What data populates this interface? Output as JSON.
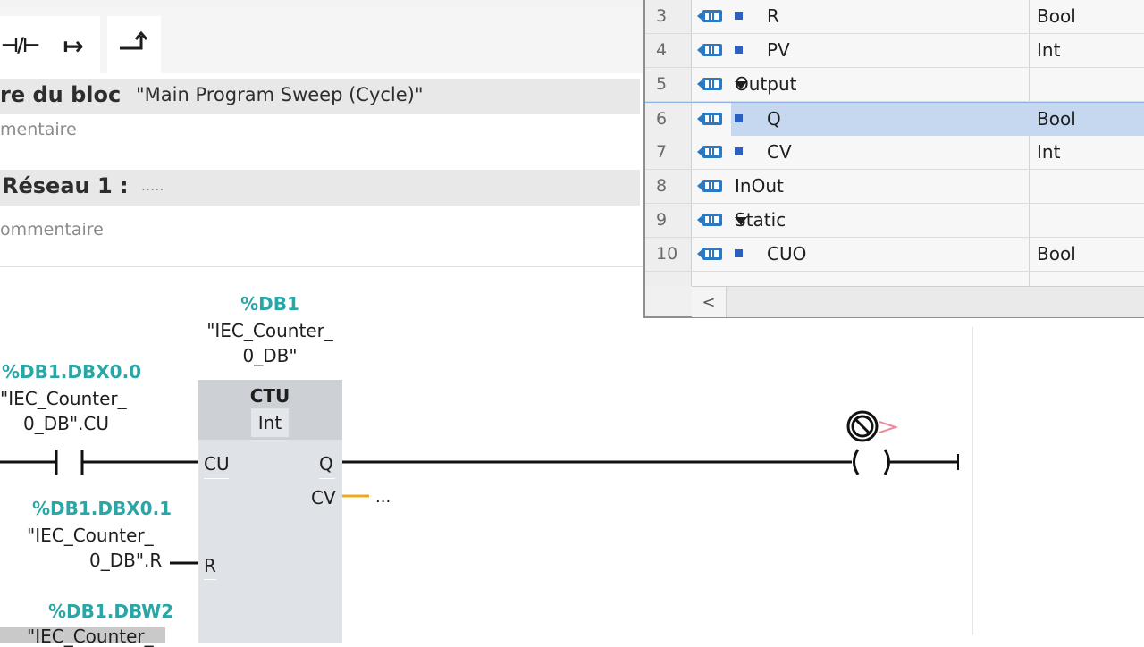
{
  "toolbar": {
    "buttons": [
      {
        "icon": "nc-contact-icon",
        "glyph": "⫫"
      },
      {
        "icon": "open-branch-icon",
        "glyph": "↦"
      },
      {
        "icon": "close-branch-icon",
        "glyph": "⬏"
      }
    ]
  },
  "block": {
    "title_label": "re du bloc",
    "title_value": "\"Main Program Sweep (Cycle)\"",
    "comment": "mentaire"
  },
  "network": {
    "title": "Réseau 1 :",
    "title_dots": ".....",
    "comment": "ommentaire"
  },
  "interface": {
    "rows": [
      {
        "num": "3",
        "name": "R",
        "type": "Bool",
        "marker": "square",
        "indent": 1
      },
      {
        "num": "4",
        "name": "PV",
        "type": "Int",
        "marker": "square",
        "indent": 1
      },
      {
        "num": "5",
        "name": "Output",
        "type": "",
        "marker": "expand",
        "indent": 0
      },
      {
        "num": "6",
        "name": "Q",
        "type": "Bool",
        "marker": "square",
        "indent": 1,
        "selected": true
      },
      {
        "num": "7",
        "name": "CV",
        "type": "Int",
        "marker": "square",
        "indent": 1
      },
      {
        "num": "8",
        "name": "InOut",
        "type": "",
        "marker": "none",
        "indent": 0
      },
      {
        "num": "9",
        "name": "Static",
        "type": "",
        "marker": "expand",
        "indent": 0
      },
      {
        "num": "10",
        "name": "CUO",
        "type": "Bool",
        "marker": "square",
        "indent": 1
      }
    ],
    "scroll_left_glyph": "<"
  },
  "ladder": {
    "instance_db": "%DB1",
    "instance_name_1": "\"IEC_Counter_",
    "instance_name_2": "0_DB\"",
    "fb_type": "CTU",
    "fb_datatype": "Int",
    "pin_cu": "CU",
    "pin_r": "R",
    "pin_q": "Q",
    "pin_cv": "CV",
    "cv_value": "...",
    "cu_addr": "%DB1.DBX0.0",
    "cu_name_1": "\"IEC_Counter_",
    "cu_name_2": "0_DB\".CU",
    "r_addr": "%DB1.DBX0.1",
    "r_name_1": "\"IEC_Counter_",
    "r_name_2": "0_DB\".R",
    "pv_addr": "%DB1.DBW2",
    "pv_name_1": "\"IEC_Counter_"
  },
  "colors": {
    "teal": "#2aa6a6",
    "selection": "#c6d8ef",
    "orange_wire": "#f0a81c"
  }
}
